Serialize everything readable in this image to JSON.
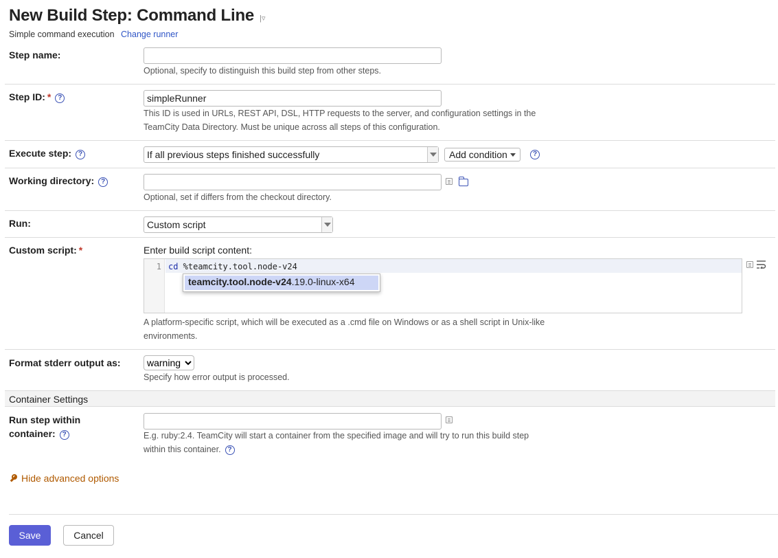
{
  "header": {
    "title": "New Build Step: Command Line",
    "subtitle": "Simple command execution",
    "change_runner": "Change runner",
    "title_menu_icon": "dropdown-icon"
  },
  "step_name": {
    "label": "Step name:",
    "value": "",
    "hint": "Optional, specify to distinguish this build step from other steps."
  },
  "step_id": {
    "label": "Step ID:",
    "required": "*",
    "value": "simpleRunner",
    "hint_line1": "This ID is used in URLs, REST API, DSL, HTTP requests to the server, and configuration settings in the",
    "hint_line2": "TeamCity Data Directory. Must be unique across all steps of this configuration."
  },
  "execute_step": {
    "label": "Execute step:",
    "value": "If all previous steps finished successfully",
    "add_condition": "Add condition"
  },
  "working_directory": {
    "label": "Working directory:",
    "value": "",
    "hint": "Optional, set if differs from the checkout directory."
  },
  "run": {
    "label": "Run:",
    "value": "Custom script"
  },
  "custom_script": {
    "label": "Custom script:",
    "required": "*",
    "intro": "Enter build script content:",
    "line_number": "1",
    "code_keyword": "cd",
    "code_rest": " %teamcity.tool.node-v24",
    "autocomplete_match": "teamcity.tool.node-v24",
    "autocomplete_rest": ".19.0-linux-x64",
    "hint_line1": "A platform-specific script, which will be executed as a .cmd file on Windows or as a shell script in Unix-like",
    "hint_line2": "environments."
  },
  "stderr": {
    "label": "Format stderr output as:",
    "value": "warning",
    "options": [
      "warning"
    ],
    "hint": "Specify how error output is processed."
  },
  "container": {
    "section_title": "Container Settings",
    "label_line1": "Run step within",
    "label_line2": "container:",
    "value": "",
    "hint_line1": "E.g. ruby:2.4. TeamCity will start a container from the specified image and will try to run this build step",
    "hint_line2": "within this container."
  },
  "advanced": {
    "toggle": "Hide advanced options"
  },
  "footer": {
    "save": "Save",
    "cancel": "Cancel"
  },
  "help_glyph": "?",
  "colors": {
    "accent": "#5a5fd6",
    "link": "#2f55c6",
    "advanced_link": "#b05a00",
    "required": "#c0392b"
  }
}
